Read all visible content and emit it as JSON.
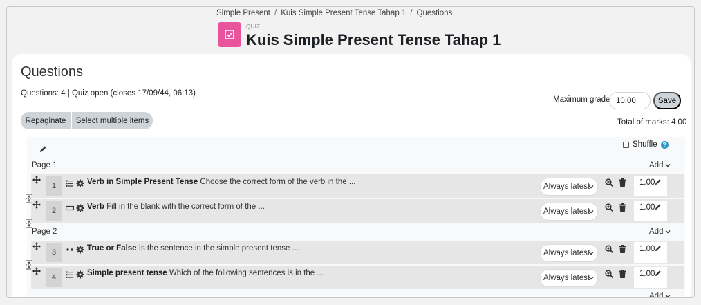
{
  "breadcrumb": [
    "Simple Present",
    "Kuis Simple Present Tense Tahap 1",
    "Questions"
  ],
  "breadcrumb_sep": "/",
  "header": {
    "type_label": "QUIZ",
    "title": "Kuis Simple Present Tense Tahap 1",
    "icon": "quiz-checkbox-icon",
    "icon_color": "#e8559d"
  },
  "questions_panel": {
    "heading": "Questions",
    "status": "Questions: 4 | Quiz open (closes 17/09/44, 06:13)",
    "repaginate_label": "Repaginate",
    "select_multiple_label": "Select multiple items",
    "max_grade_label": "Maximum grade",
    "max_grade_value": "10.00",
    "save_label": "Save",
    "total_marks": "Total of marks: 4.00",
    "shuffle_label": "Shuffle",
    "shuffle_checked": false
  },
  "add_label": "Add",
  "pages": [
    {
      "label": "Page 1",
      "questions": [
        {
          "num": "1",
          "type_icon": "multichoice-icon",
          "name": "Verb in Simple Present Tense",
          "text": "Choose the correct form of the verb in the ...",
          "behaviour": "Always latest",
          "mark": "1.00"
        },
        {
          "num": "2",
          "type_icon": "shortanswer-icon",
          "name": "Verb",
          "text": "Fill in the blank with the correct form of the ...",
          "behaviour": "Always latest",
          "mark": "1.00"
        }
      ]
    },
    {
      "label": "Page 2",
      "questions": [
        {
          "num": "3",
          "type_icon": "truefalse-icon",
          "name": "True or False",
          "text": "Is the sentence in the simple present tense ...",
          "behaviour": "Always latest",
          "mark": "1.00"
        },
        {
          "num": "4",
          "type_icon": "multichoice-icon",
          "name": "Simple present tense",
          "text": "Which of the following sentences is in the ...",
          "behaviour": "Always latest",
          "mark": "1.00"
        }
      ]
    }
  ],
  "colors": {
    "accent_pink": "#e8559d",
    "help_blue": "#2e97c8",
    "button_grey": "#ced4da",
    "row_bg": "#e6e6e6"
  }
}
